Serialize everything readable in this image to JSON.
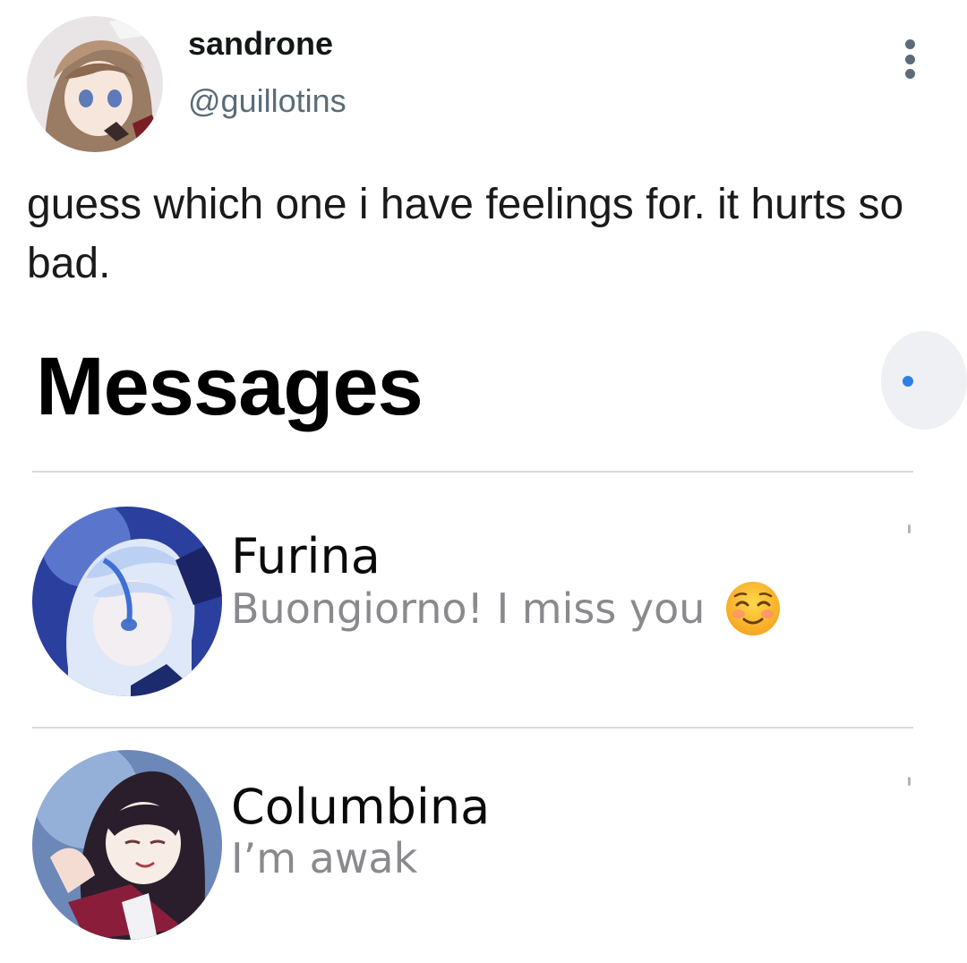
{
  "author": {
    "display_name": "sandrone",
    "handle": "@guillotins",
    "avatar_icon": "anime-avatar-icon",
    "menu_icon": "more-vertical-icon"
  },
  "tweet": {
    "text": "guess which one i have feelings for. it hurts so bad."
  },
  "embedded_screenshot": {
    "title": "Messages",
    "conversations": [
      {
        "name": "Furina",
        "preview": "Buongiorno! I miss you",
        "emoji": "smiling-blush-emoji-icon",
        "avatar_icon": "furina-avatar-icon"
      },
      {
        "name": "Columbina",
        "preview": "I’m awak",
        "avatar_icon": "columbina-avatar-icon"
      }
    ]
  },
  "colors": {
    "text_primary": "#14171a",
    "text_secondary": "#5b6b78",
    "preview_gray": "#8a8a8e",
    "accent_blue": "#2f7ee6"
  }
}
